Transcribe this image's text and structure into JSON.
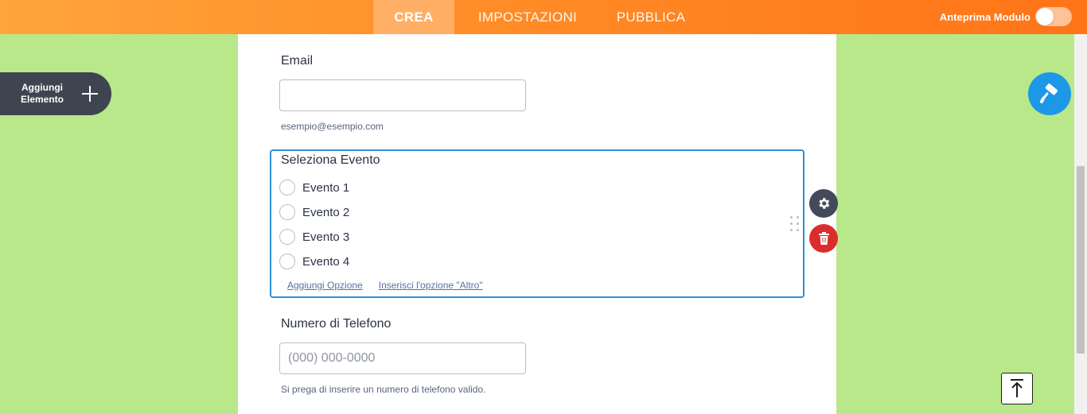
{
  "topbar": {
    "tabs": [
      {
        "label": "CREA",
        "active": true
      },
      {
        "label": "IMPOSTAZIONI",
        "active": false
      },
      {
        "label": "PUBBLICA",
        "active": false
      }
    ],
    "preview_label": "Anteprima Modulo",
    "preview_enabled": false
  },
  "add_element": {
    "label_line1": "Aggiungi",
    "label_line2": "Elemento"
  },
  "form": {
    "email": {
      "label": "Email",
      "value": "",
      "sublabel": "esempio@esempio.com"
    },
    "event": {
      "label": "Seleziona Evento",
      "options": [
        "Evento 1",
        "Evento 2",
        "Evento 3",
        "Evento 4"
      ],
      "add_option": "Aggiungi Opzione",
      "add_other": "Inserisci l'opzione \"Altro\""
    },
    "phone": {
      "label": "Numero di Telefono",
      "placeholder": "(000) 000-0000",
      "sublabel": "Si prega di inserire un numero di telefono valido."
    }
  },
  "colors": {
    "topbar_start": "#ffa53a",
    "topbar_end": "#ff7418",
    "background": "#b9e88a",
    "selected_border": "#2e8fdb",
    "designer_button": "#1d98e8",
    "delete_button": "#dc2c2c",
    "settings_button": "#434a5a"
  },
  "icons": {
    "add": "plus-icon",
    "designer": "paint-roller-icon",
    "settings": "gear-icon",
    "delete": "trash-icon",
    "drag": "drag-handle-icon",
    "scroll_top": "arrow-up-to-line-icon"
  }
}
